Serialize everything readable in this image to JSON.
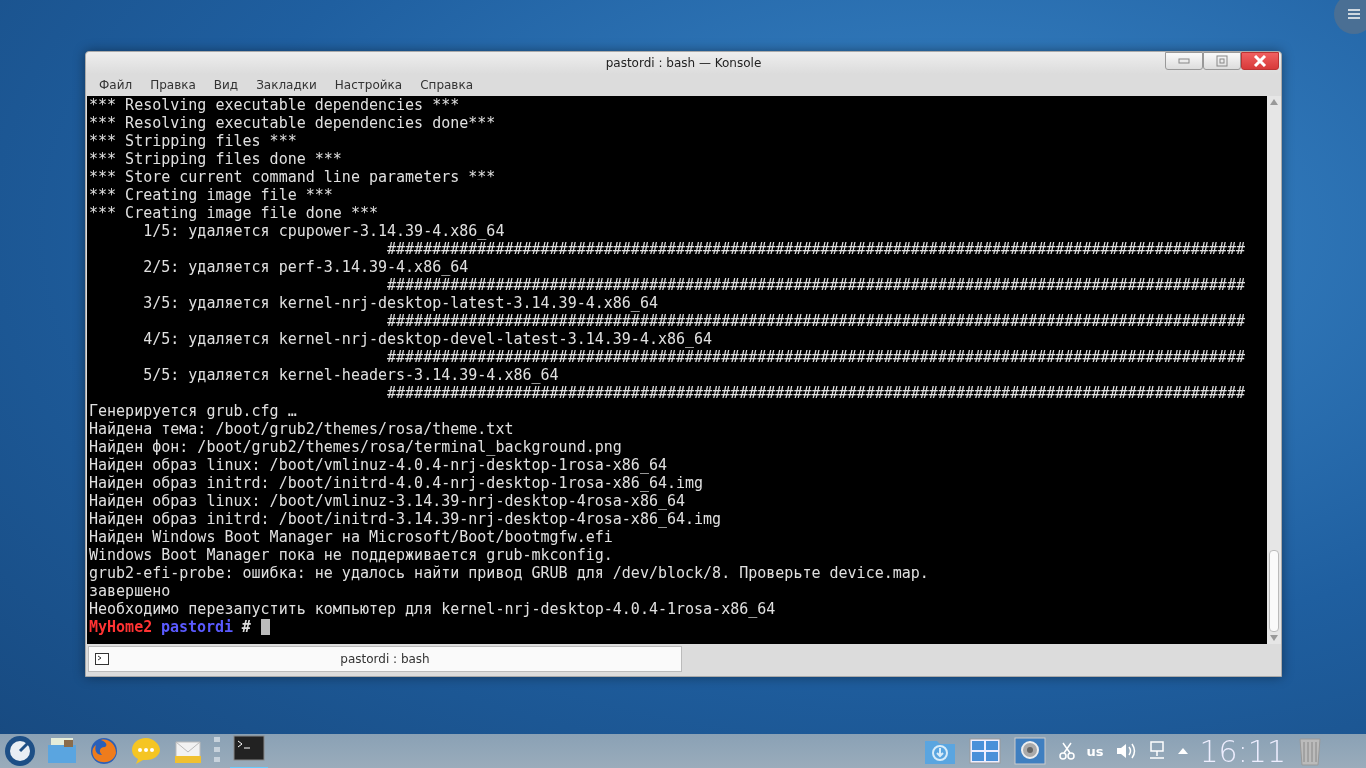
{
  "window": {
    "title": "pastordi : bash — Konsole"
  },
  "menu": [
    "Файл",
    "Правка",
    "Вид",
    "Закладки",
    "Настройка",
    "Справка"
  ],
  "terminal": {
    "lines": [
      {
        "kind": "text",
        "text": "*** Resolving executable dependencies ***"
      },
      {
        "kind": "text",
        "text": "*** Resolving executable dependencies done***"
      },
      {
        "kind": "text",
        "text": "*** Stripping files ***"
      },
      {
        "kind": "text",
        "text": "*** Stripping files done ***"
      },
      {
        "kind": "text",
        "text": "*** Store current command line parameters ***"
      },
      {
        "kind": "text",
        "text": "*** Creating image file ***"
      },
      {
        "kind": "text",
        "text": "*** Creating image file done ***"
      },
      {
        "kind": "text",
        "text": "      1/5: удаляется cpupower-3.14.39-4.x86_64"
      },
      {
        "kind": "text",
        "text": "                                 ###############################################################################################"
      },
      {
        "kind": "text",
        "text": "      2/5: удаляется perf-3.14.39-4.x86_64"
      },
      {
        "kind": "text",
        "text": "                                 ###############################################################################################"
      },
      {
        "kind": "text",
        "text": "      3/5: удаляется kernel-nrj-desktop-latest-3.14.39-4.x86_64"
      },
      {
        "kind": "text",
        "text": "                                 ###############################################################################################"
      },
      {
        "kind": "text",
        "text": "      4/5: удаляется kernel-nrj-desktop-devel-latest-3.14.39-4.x86_64"
      },
      {
        "kind": "text",
        "text": "                                 ###############################################################################################"
      },
      {
        "kind": "text",
        "text": "      5/5: удаляется kernel-headers-3.14.39-4.x86_64"
      },
      {
        "kind": "text",
        "text": "                                 ###############################################################################################"
      },
      {
        "kind": "text",
        "text": "Генерируется grub.cfg …"
      },
      {
        "kind": "text",
        "text": "Найдена тема: /boot/grub2/themes/rosa/theme.txt"
      },
      {
        "kind": "text",
        "text": "Найден фон: /boot/grub2/themes/rosa/terminal_background.png"
      },
      {
        "kind": "text",
        "text": "Найден образ linux: /boot/vmlinuz-4.0.4-nrj-desktop-1rosa-x86_64"
      },
      {
        "kind": "text",
        "text": "Найден образ initrd: /boot/initrd-4.0.4-nrj-desktop-1rosa-x86_64.img"
      },
      {
        "kind": "text",
        "text": "Найден образ linux: /boot/vmlinuz-3.14.39-nrj-desktop-4rosa-x86_64"
      },
      {
        "kind": "text",
        "text": "Найден образ initrd: /boot/initrd-3.14.39-nrj-desktop-4rosa-x86_64.img"
      },
      {
        "kind": "text",
        "text": "Найден Windows Boot Manager на Microsoft/Boot/bootmgfw.efi"
      },
      {
        "kind": "text",
        "text": "Windows Boot Manager пока не поддерживается grub-mkconfig."
      },
      {
        "kind": "text",
        "text": "grub2-efi-probe: ошибка: не удалось найти привод GRUB для /dev/block/8. Проверьте device.map."
      },
      {
        "kind": "text",
        "text": "завершено"
      },
      {
        "kind": "text",
        "text": "Необходимо перезапустить компьютер для kernel-nrj-desktop-4.0.4-1rosa-x86_64"
      },
      {
        "kind": "prompt",
        "host": "MyHome2",
        "user": "pastordi",
        "symbol": "#"
      }
    ]
  },
  "tabs": [
    {
      "label": "pastordi : bash",
      "selected": true
    }
  ],
  "taskbar": {
    "keyboard_layout": "us",
    "clock": "16:11"
  }
}
